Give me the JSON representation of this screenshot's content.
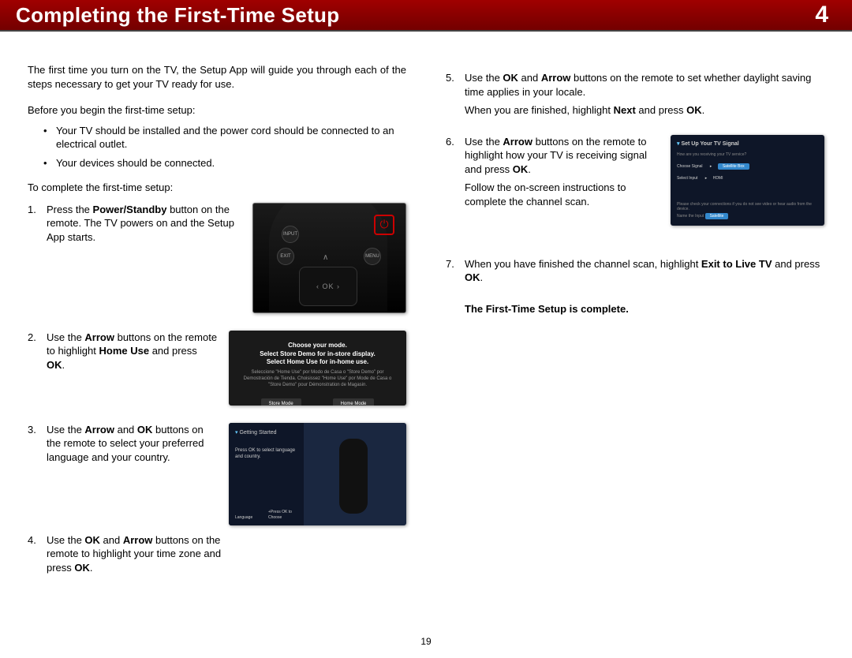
{
  "header": {
    "title": "Completing the First-Time Setup",
    "chapter": "4"
  },
  "page_number": "19",
  "left": {
    "intro": "The first time you turn on the TV, the Setup App will guide you through each of the steps necessary to get your TV ready for use.",
    "before_heading": "Before you begin the first-time setup:",
    "before": [
      "Your TV should be installed and the power cord should be connected to an electrical outlet.",
      "Your devices should be connected."
    ],
    "to_complete": "To complete the first-time setup:",
    "steps": {
      "s1": {
        "num": "1.",
        "a": "Press the ",
        "b": "Power/Standby",
        "c": " button on the remote. The TV powers on and the Setup App starts."
      },
      "s2": {
        "num": "2.",
        "a": "Use the ",
        "b": "Arrow",
        "c": " buttons on the remote to highlight ",
        "d": "Home Use",
        "e": " and press ",
        "f": "OK",
        "g": "."
      },
      "s3": {
        "num": "3.",
        "a": "Use the ",
        "b": "Arrow",
        "c": " and ",
        "d": "OK",
        "e": " buttons on the remote to select your preferred language and your country."
      },
      "s4": {
        "num": "4.",
        "a": "Use the ",
        "b": "OK",
        "c": " and ",
        "d": "Arrow",
        "e": " buttons on the remote to highlight your time zone and press ",
        "f": "OK",
        "g": "."
      }
    },
    "fig_remote": {
      "input": "INPUT",
      "exit": "EXIT",
      "menu": "MENU"
    },
    "fig_mode": {
      "l1": "Choose your mode.",
      "l2": "Select Store Demo for in-store display.",
      "l3": "Select Home Use for in-home use.",
      "sub": "Seleccione \"Home Use\" por Modo de Casa o \"Store Demo\" por Demostración de Tienda. Choisissez \"Home Use\" por Mode de Casa o \"Store Demo\" pour Démonstration de Magasin.",
      "btn1": "Store Mode",
      "btn2": "Home Mode"
    },
    "fig_lang": {
      "gs": "Getting Started",
      "p": "Press OK to select language and country.",
      "lang": "Language",
      "pc": "+Press OK to Choose"
    }
  },
  "right": {
    "steps": {
      "s5": {
        "num": "5.",
        "a": "Use the ",
        "b": "OK",
        "c": " and ",
        "d": "Arrow",
        "e": " buttons on the remote to set whether daylight saving time applies in your locale.",
        "p2a": "When you are finished, highlight ",
        "p2b": "Next",
        "p2c": " and press ",
        "p2d": "OK",
        "p2e": "."
      },
      "s6": {
        "num": "6.",
        "a": "Use the ",
        "b": "Arrow",
        "c": " buttons on the remote to highlight how your TV is receiving signal and press ",
        "d": "OK",
        "e": ".",
        "p2": "Follow the on-screen instructions to complete the channel scan."
      },
      "s7": {
        "num": "7.",
        "a": "When you have finished the channel scan, highlight ",
        "b": "Exit to Live TV",
        "c": " and press ",
        "d": "OK",
        "e": "."
      }
    },
    "completion": "The First-Time Setup is complete.",
    "fig_signal": {
      "hdr": "Set Up Your TV Signal",
      "q": "How are you receiving your TV service?",
      "o1": "Choose Signal",
      "o1v": "Satellite Box",
      "o2": "Select Input",
      "o2v": "HDMI",
      "note": "Please check your connections if you do not see video or hear audio from the device.",
      "ni": "Name the Input",
      "btn": "Satellite"
    }
  }
}
